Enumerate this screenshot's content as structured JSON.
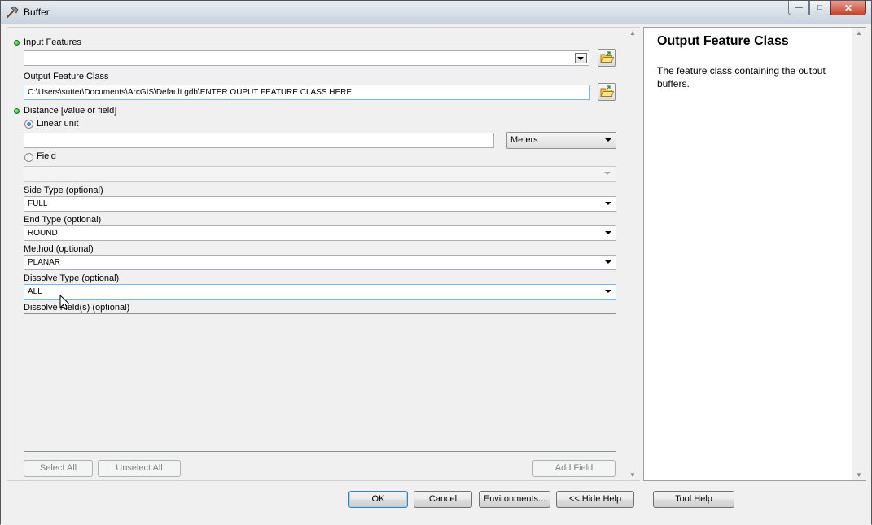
{
  "window": {
    "title": "Buffer",
    "minimize_glyph": "—",
    "maximize_glyph": "□",
    "close_glyph": "✕"
  },
  "form": {
    "input_features": {
      "label": "Input Features",
      "value": ""
    },
    "output_feature_class": {
      "label": "Output Feature Class",
      "value": "C:\\Users\\sutter\\Documents\\ArcGIS\\Default.gdb\\ENTER OUPUT FEATURE CLASS HERE"
    },
    "distance": {
      "label": "Distance [value or field]",
      "linear_unit_label": "Linear unit",
      "linear_unit_value": "",
      "unit": "Meters",
      "field_label": "Field",
      "field_value": "",
      "selected": "Linear unit"
    },
    "side_type": {
      "label": "Side Type (optional)",
      "value": "FULL"
    },
    "end_type": {
      "label": "End Type (optional)",
      "value": "ROUND"
    },
    "method": {
      "label": "Method (optional)",
      "value": "PLANAR"
    },
    "dissolve_type": {
      "label": "Dissolve Type (optional)",
      "value": "ALL"
    },
    "dissolve_fields": {
      "label": "Dissolve Field(s) (optional)"
    },
    "select_all_label": "Select All",
    "unselect_all_label": "Unselect All",
    "add_field_label": "Add Field"
  },
  "help": {
    "title": "Output Feature Class",
    "body": "The feature class containing the output buffers."
  },
  "buttons": {
    "ok": "OK",
    "cancel": "Cancel",
    "environments": "Environments...",
    "hide_help": "<< Hide Help",
    "tool_help": "Tool Help"
  },
  "colors": {
    "required_dot": "#1aa21a",
    "default_button_border": "#3c7fb1"
  }
}
